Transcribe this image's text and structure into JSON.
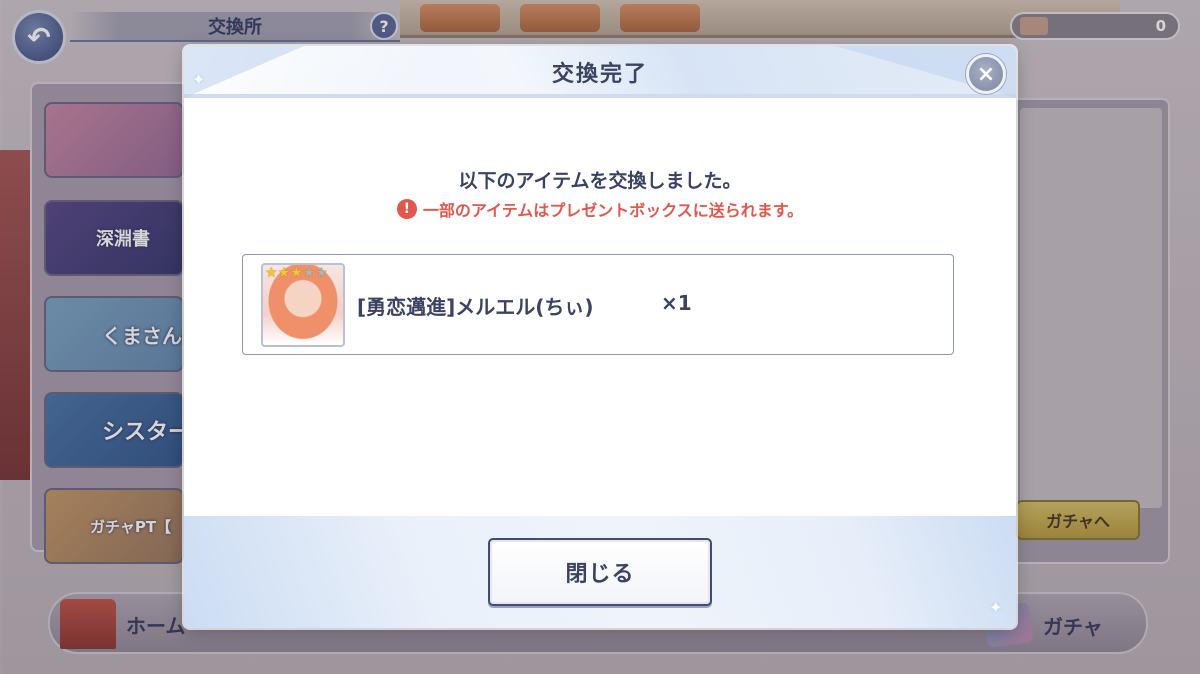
{
  "background": {
    "screen_title": "交換所",
    "help_label": "?",
    "back_label": "↶",
    "currency_value": "0",
    "banners": [
      {
        "label": ""
      },
      {
        "label": "深淵書"
      },
      {
        "label": "くまさん祭"
      },
      {
        "label": "シスター"
      },
      {
        "label": "ガチャPT【"
      }
    ],
    "gacha_link_label": "ガチャへ",
    "nav": {
      "home_label": "ホーム",
      "gacha_label": "ガチャ"
    }
  },
  "dialog": {
    "title": "交換完了",
    "close_icon": "×",
    "message": "以下のアイテムを交換しました。",
    "warning_icon": "!",
    "warning": "一部のアイテムはプレゼントボックスに送られます。",
    "items": [
      {
        "name": "[勇恋邁進]メルエル(ちぃ)",
        "quantity": "×1",
        "rarity_filled": 3,
        "rarity_total": 5
      }
    ],
    "close_button_label": "閉じる"
  },
  "colors": {
    "title_text": "#3b4263",
    "warning_text": "#e2574c",
    "header_tint": "#e4ecf7"
  }
}
